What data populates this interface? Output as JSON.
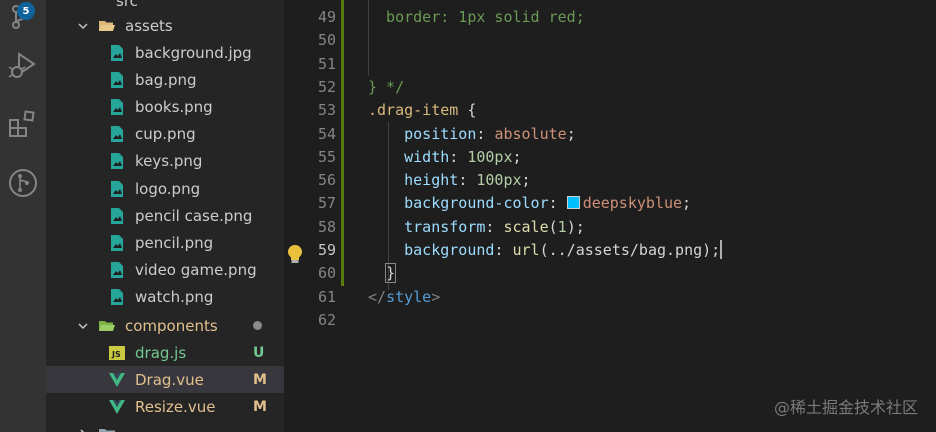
{
  "activity_bar": {
    "items": [
      {
        "name": "source-control",
        "icon": "source-control-icon",
        "badge": "5"
      },
      {
        "name": "run-debug",
        "icon": "run-debug-icon"
      },
      {
        "name": "extensions",
        "icon": "extensions-icon"
      },
      {
        "name": "git-graph",
        "icon": "git-graph-icon"
      }
    ]
  },
  "explorer": {
    "top_partial_label": "src",
    "assets_folder": "assets",
    "assets_files": [
      "background.jpg",
      "bag.png",
      "books.png",
      "cup.png",
      "keys.png",
      "logo.png",
      "pencil case.png",
      "pencil.png",
      "video game.png",
      "watch.png"
    ],
    "components_folder": "components",
    "components_files": [
      {
        "name": "drag.js",
        "status": "U",
        "status_color": "#73c991",
        "name_color": "#73c991",
        "type": "js"
      },
      {
        "name": "Drag.vue",
        "status": "M",
        "status_color": "#e2c08d",
        "name_color": "#e2c08d",
        "type": "vue"
      },
      {
        "name": "Resize.vue",
        "status": "M",
        "status_color": "#e2c08d",
        "name_color": "#e2c08d",
        "type": "vue"
      }
    ],
    "bottom_partial_label": "views"
  },
  "editor": {
    "lines": [
      {
        "n": "49",
        "tokens": [
          {
            "t": "  border",
            "c": "cmt"
          },
          {
            "t": ": 1px solid red;",
            "c": "cmt"
          }
        ]
      },
      {
        "n": "50",
        "tokens": []
      },
      {
        "n": "51",
        "tokens": []
      },
      {
        "n": "52",
        "tokens": [
          {
            "t": "} */",
            "c": "cmt"
          }
        ]
      },
      {
        "n": "53",
        "tokens": [
          {
            "t": ".drag-item",
            "c": "sel"
          },
          {
            "t": " ",
            "c": "punc"
          },
          {
            "t": "{",
            "c": "punc"
          }
        ]
      },
      {
        "n": "54",
        "tokens": [
          {
            "t": "    position",
            "c": "prop"
          },
          {
            "t": ": ",
            "c": "punc"
          },
          {
            "t": "absolute",
            "c": "val"
          },
          {
            "t": ";",
            "c": "punc"
          }
        ]
      },
      {
        "n": "55",
        "tokens": [
          {
            "t": "    width",
            "c": "prop"
          },
          {
            "t": ": ",
            "c": "punc"
          },
          {
            "t": "100px",
            "c": "num"
          },
          {
            "t": ";",
            "c": "punc"
          }
        ]
      },
      {
        "n": "56",
        "tokens": [
          {
            "t": "    height",
            "c": "prop"
          },
          {
            "t": ": ",
            "c": "punc"
          },
          {
            "t": "100px",
            "c": "num"
          },
          {
            "t": ";",
            "c": "punc"
          }
        ]
      },
      {
        "n": "57",
        "tokens": [
          {
            "t": "    background-color",
            "c": "prop"
          },
          {
            "t": ": ",
            "c": "punc"
          },
          {
            "t": "deepskyblue",
            "c": "val",
            "swatch": "#00bfff"
          },
          {
            "t": ";",
            "c": "punc"
          }
        ]
      },
      {
        "n": "58",
        "tokens": [
          {
            "t": "    transform",
            "c": "prop"
          },
          {
            "t": ": ",
            "c": "punc"
          },
          {
            "t": "scale",
            "c": "fn"
          },
          {
            "t": "(",
            "c": "punc"
          },
          {
            "t": "1",
            "c": "num"
          },
          {
            "t": ");",
            "c": "punc"
          }
        ]
      },
      {
        "n": "59",
        "tokens": [
          {
            "t": "    background",
            "c": "prop"
          },
          {
            "t": ": ",
            "c": "punc"
          },
          {
            "t": "url",
            "c": "fn"
          },
          {
            "t": "(../assets/bag.png);",
            "c": "punc"
          }
        ],
        "active": true,
        "cursor": true
      },
      {
        "n": "60",
        "tokens": [
          {
            "t": "  ",
            "c": "punc"
          },
          {
            "t": "}",
            "c": "punc",
            "hl": true
          }
        ]
      },
      {
        "n": "61",
        "tokens": [
          {
            "t": "</",
            "c": "tagb"
          },
          {
            "t": "style",
            "c": "tag"
          },
          {
            "t": ">",
            "c": "tagb"
          }
        ]
      },
      {
        "n": "62",
        "tokens": []
      }
    ]
  },
  "watermark": "@稀土掘金技术社区",
  "colors": {
    "activity_bg": "#333333",
    "sidebar_bg": "#252526",
    "editor_bg": "#1e1e1e",
    "selection": "#37373d",
    "badge": "#0e639c",
    "folder": "#dcb67a",
    "vue": "#41b883",
    "image_file": "#26a69a"
  }
}
